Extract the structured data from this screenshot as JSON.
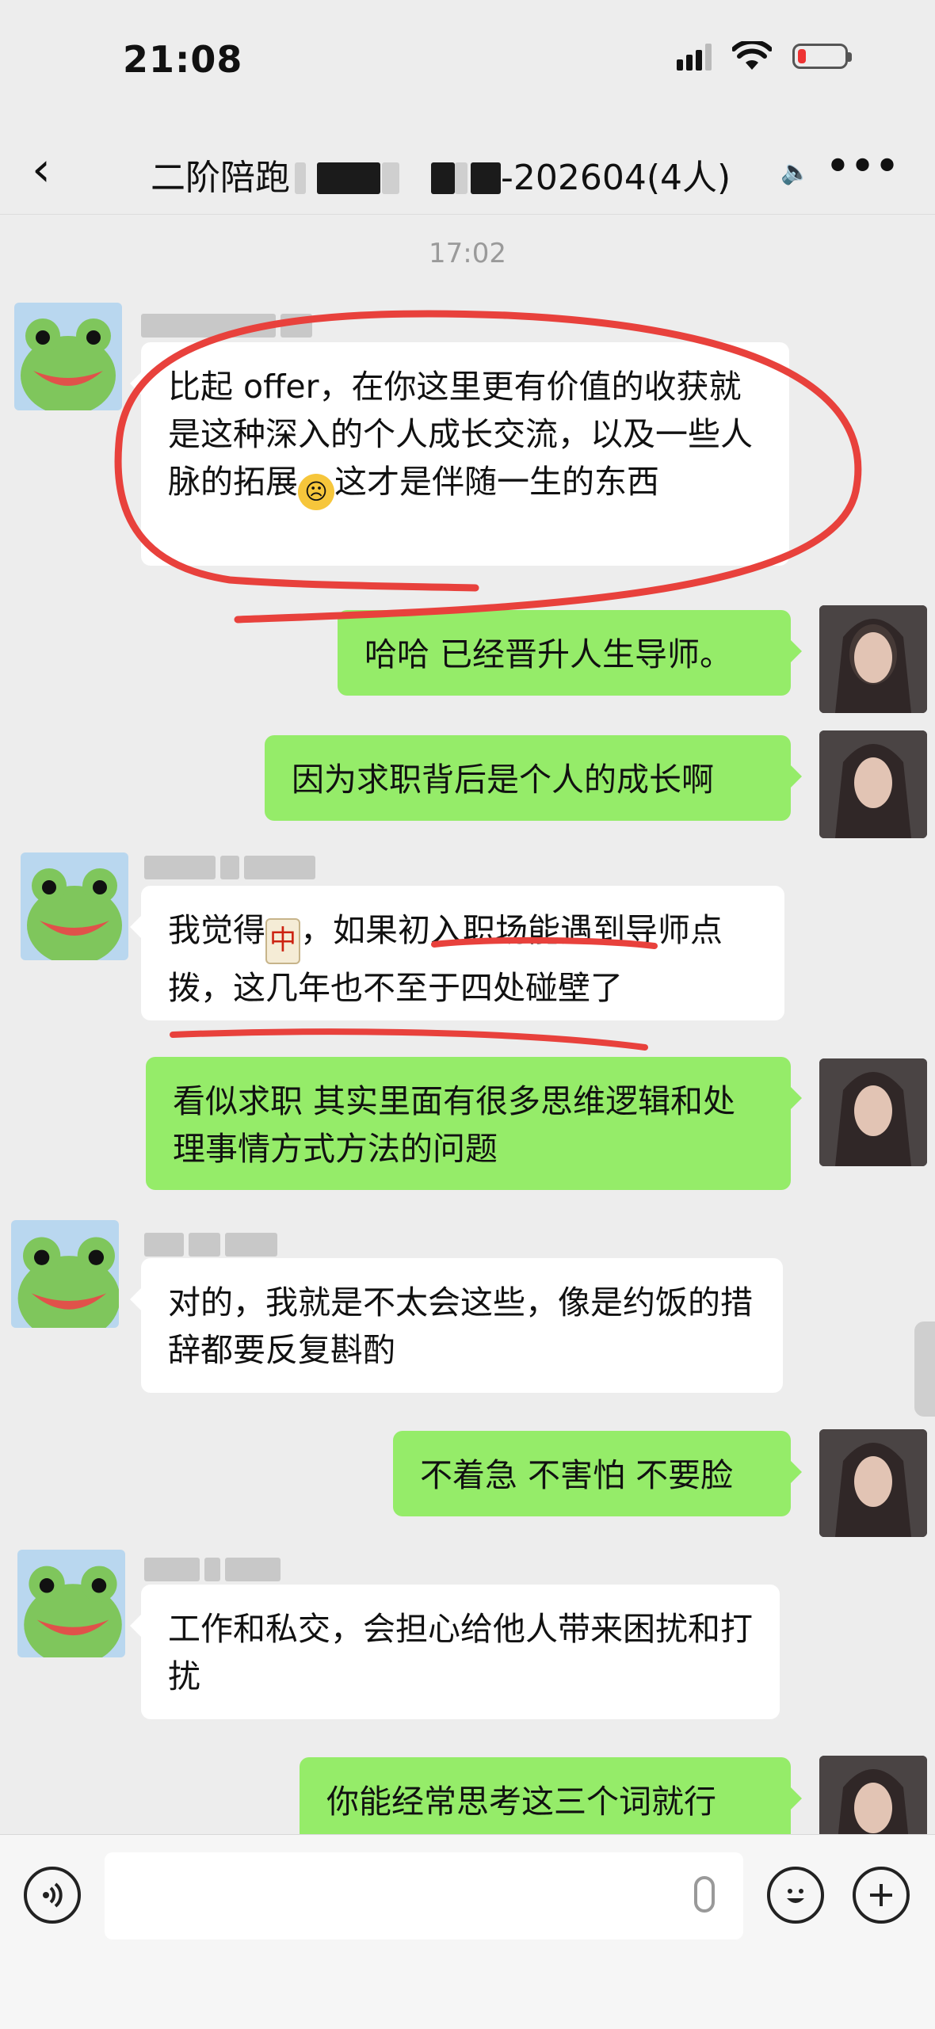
{
  "status": {
    "time": "21:08"
  },
  "nav": {
    "back_icon": "chevron-left",
    "title_prefix": "二阶陪跑",
    "title_suffix": "-202604(4人)",
    "more_icon": "ellipsis"
  },
  "chat": {
    "timestamp": "17:02",
    "messages": [
      {
        "dir": "in",
        "text1": "比起 offer，在你这里更有价值的收获就是这种深入的个人成长交流，以及一些人脉的拓展",
        "text2": "这才是伴随一生的东西"
      },
      {
        "dir": "out",
        "text": "哈哈 已经晋升人生导师。"
      },
      {
        "dir": "out",
        "text": "因为求职背后是个人的成长啊"
      },
      {
        "dir": "in",
        "text1": "我觉得",
        "tile": "中",
        "text2": "，如果初入职场能遇到导师点拨，这几年也不至于四处碰壁了"
      },
      {
        "dir": "out",
        "text": "看似求职 其实里面有很多思维逻辑和处理事情方式方法的问题"
      },
      {
        "dir": "in",
        "text": "对的，我就是不太会这些，像是约饭的措辞都要反复斟酌"
      },
      {
        "dir": "out",
        "text": "不着急 不害怕 不要脸"
      },
      {
        "dir": "in",
        "text": "工作和私交，会担心给他人带来困扰和打扰"
      },
      {
        "dir": "out",
        "text": "你能经常思考这三个词就行"
      }
    ]
  },
  "annotation_color": "#e8413c",
  "input_bar": {
    "voice_icon": "voice-icon",
    "mic_icon": "microphone-icon",
    "emoji_icon": "smiley-icon",
    "plus_icon": "plus-icon"
  }
}
